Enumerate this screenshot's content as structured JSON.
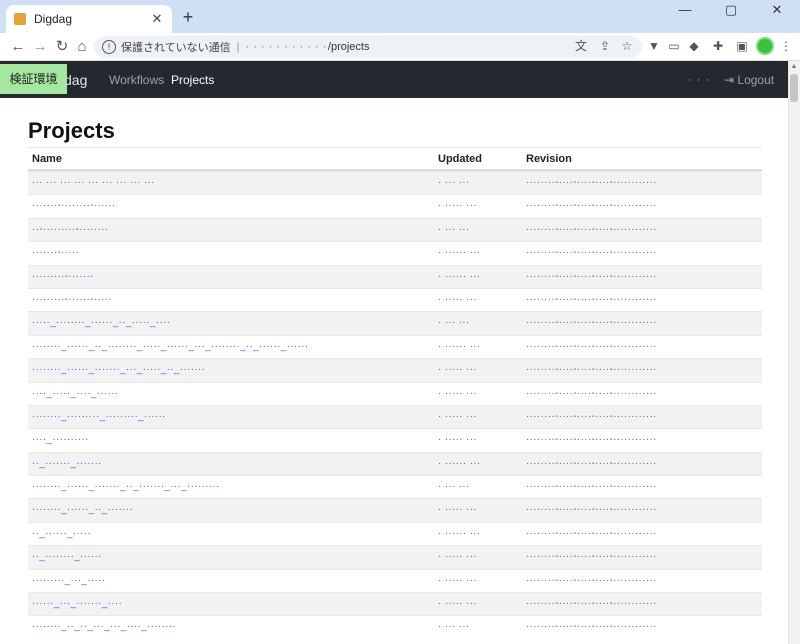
{
  "browser": {
    "tab_title": "Digdag",
    "tab_close": "✕",
    "new_tab": "+",
    "omnibox": {
      "security_label": "保護されていない通信",
      "host": "· · · · · · · · · · ·",
      "path": "/projects"
    },
    "window": {
      "minimize": "—",
      "maximize": "▢",
      "close": "✕"
    }
  },
  "app": {
    "env_badge": "検証環境",
    "brand": "dag",
    "nav": {
      "workflows": "Workflows",
      "projects": "Projects"
    },
    "user": "· · ·",
    "logout": "Logout"
  },
  "page": {
    "title": "Projects",
    "columns": {
      "name": "Name",
      "updated": "Updated",
      "revision": "Revision"
    },
    "rows": [
      {
        "name": "··· ··· ··· ··· ··· ··· ··· ··· ···",
        "updated": "· ··· ···",
        "revision": "········-····-····-····-············"
      },
      {
        "name": "·······-········-······",
        "updated": "· ····· ···",
        "revision": "········-····-····-····-············"
      },
      {
        "name": "··-·········-········",
        "updated": "· ··· ···",
        "revision": "········-····-····-····-············"
      },
      {
        "name": "·······-·····",
        "updated": "· ······ ···",
        "revision": "········-····-····-····-············"
      },
      {
        "name": "·········-·······",
        "updated": "· ······ ···",
        "revision": "········-····-····-····-············"
      },
      {
        "name": "·········-······-·····",
        "updated": "· ····· ···",
        "revision": "········-····-····-····-············"
      },
      {
        "name": "·····_········_······_··_·····_····",
        "updated": "· ··· ···",
        "revision": "········-····-····-····-············"
      },
      {
        "name": "········_······_··_········_·····_······_···_········_··_······_······",
        "updated": "· ······ ···",
        "revision": "········-····-····-····-············"
      },
      {
        "name": "········_······_·······_···_·····_··_·······",
        "updated": "· ····· ···",
        "revision": "········-····-····-····-············"
      },
      {
        "name": "····_·····_····_······",
        "updated": "· ····· ···",
        "revision": "········-····-····-····-············"
      },
      {
        "name": "········_·········_·········_······",
        "updated": "· ····· ···",
        "revision": "········-····-····-····-············"
      },
      {
        "name": "····_··········",
        "updated": "· ····· ···",
        "revision": "········-····-····-····-············"
      },
      {
        "name": "··_·······_·······",
        "updated": "· ······ ···",
        "revision": "········-····-····-····-············"
      },
      {
        "name": "········_······_·······_··_·······_···_·········",
        "updated": "· ··· ···",
        "revision": "········-····-····-····-············"
      },
      {
        "name": "········_······_··_·······",
        "updated": "· ····· ···",
        "revision": "········-····-····-····-············"
      },
      {
        "name": "··_······_·····",
        "updated": "· ······ ···",
        "revision": "········-····-····-····-············"
      },
      {
        "name": "··_········_······",
        "updated": "· ····· ···",
        "revision": "········-····-····-····-············"
      },
      {
        "name": "·········_···_·····",
        "updated": "· ····· ···",
        "revision": "········-····-····-····-············"
      },
      {
        "name": "······_···_·······_····",
        "updated": "· ····· ···",
        "revision": "········-····-····-····-············"
      },
      {
        "name": "········_··_··_···_···_····_········",
        "updated": "· ··· ···",
        "revision": "········-····-····-····-············"
      }
    ]
  },
  "colors": {
    "nav_bg": "#23292f",
    "link": "#2f6fd1",
    "env_badge": "#a5e6a0",
    "tab_strip": "#cfe0f5"
  },
  "icons": [
    "digdag-favicon",
    "back-arrow-icon",
    "forward-arrow-icon",
    "reload-icon",
    "insecure-warning-icon",
    "translate-icon",
    "share-icon",
    "star-icon",
    "extension-icon",
    "puzzle-icon",
    "sidebar-icon",
    "logout-icon"
  ]
}
